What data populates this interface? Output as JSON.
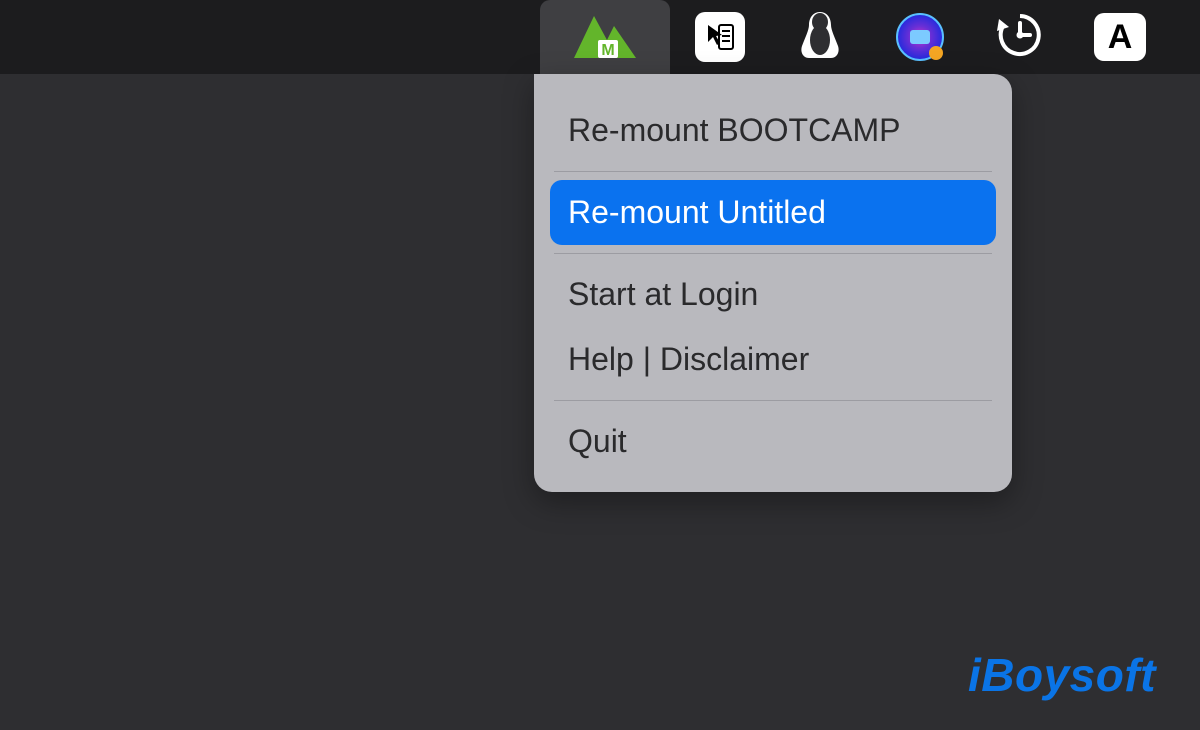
{
  "menubar": {
    "items": [
      {
        "name": "mounty-icon"
      },
      {
        "name": "cursor-app-icon"
      },
      {
        "name": "penguin-icon"
      },
      {
        "name": "swirl-icon"
      },
      {
        "name": "timemachine-icon"
      },
      {
        "name": "input-letter-a",
        "letter": "A"
      }
    ]
  },
  "dropdown": {
    "items": [
      {
        "label": "Re-mount BOOTCAMP",
        "highlight": false
      },
      {
        "label": "Re-mount Untitled",
        "highlight": true
      },
      {
        "label": "Start at Login",
        "highlight": false
      },
      {
        "label": "Help | Disclaimer",
        "highlight": false
      },
      {
        "label": "Quit",
        "highlight": false
      }
    ]
  },
  "watermark": {
    "text": "iBoysoft"
  }
}
